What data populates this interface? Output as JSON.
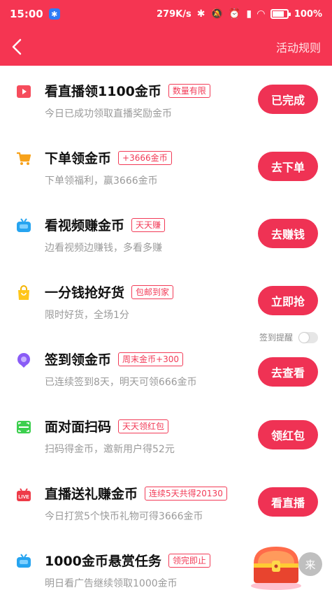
{
  "status_bar": {
    "time": "15:00",
    "network_speed": "279K/s",
    "battery": "100%",
    "battery_level": 1.0
  },
  "nav": {
    "rules_label": "活动规则"
  },
  "tasks": [
    {
      "title": "看直播领1100金币",
      "badge": "数量有限",
      "desc": "今日已成功领取直播奖励金币",
      "button": "已完成",
      "icon": "live-video-icon"
    },
    {
      "title": "下单领金币",
      "badge": "+3666金币",
      "desc": "下单领福利，赢3666金币",
      "button": "去下单",
      "icon": "shopping-cart-icon"
    },
    {
      "title": "看视频赚金币",
      "badge": "天天赚",
      "desc": "边看视频边赚钱，多看多赚",
      "button": "去赚钱",
      "icon": "tv-icon"
    },
    {
      "title": "一分钱抢好货",
      "badge": "包邮到家",
      "desc": "限时好货，全场1分",
      "button": "立即抢",
      "icon": "shopping-bag-icon"
    },
    {
      "title": "签到领金币",
      "badge": "周末金币+300",
      "desc": "已连续签到8天，明天可领666金币",
      "button": "去查看",
      "icon": "sign-in-pin-icon",
      "remind_label": "签到提醒"
    },
    {
      "title": "面对面扫码",
      "badge": "天天领红包",
      "desc": "扫码得金币，邀新用户得52元",
      "button": "领红包",
      "icon": "scan-icon"
    },
    {
      "title": "直播送礼赚金币",
      "badge": "连续5天共得20130",
      "desc": "今日打赏5个快币礼物可得3666金币",
      "button": "看直播",
      "icon": "live-gift-icon",
      "icon_text": "LIVE"
    },
    {
      "title": "1000金币悬赏任务",
      "badge": "领完即止",
      "desc": "明日看广告继续领取1000金币",
      "button": "",
      "icon": "ad-tv-icon"
    }
  ],
  "float_widget": {
    "label": "来"
  },
  "colors": {
    "brand": "#f53552",
    "button": "#ef3254",
    "badge": "#f23b57"
  }
}
